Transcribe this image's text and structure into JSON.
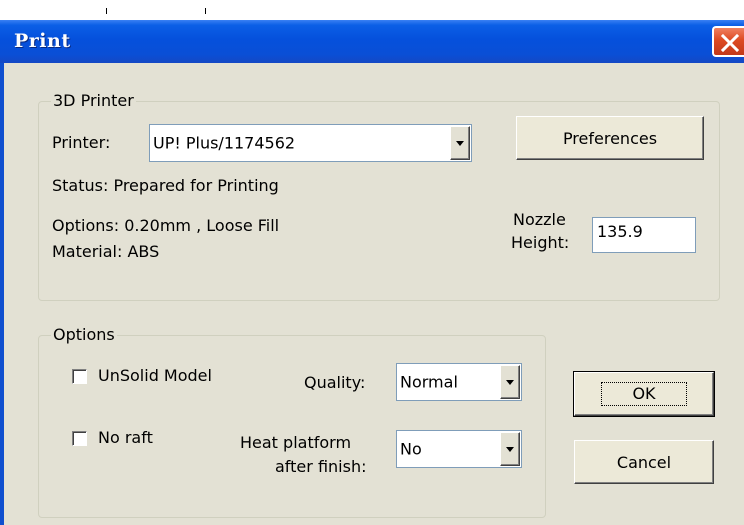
{
  "window": {
    "title": "Print"
  },
  "printer_group": {
    "legend": "3D Printer",
    "printer_label": "Printer:",
    "printer_value": "UP! Plus/1174562",
    "preferences_label": "Preferences",
    "status": "Status: Prepared for Printing",
    "options_text": "Options: 0.20mm , Loose Fill",
    "material_text": "Material: ABS",
    "nozzle_label_line1": "Nozzle",
    "nozzle_label_line2": "Height:",
    "nozzle_value": "135.9"
  },
  "options_group": {
    "legend": "Options",
    "unsolid_label": "UnSolid Model",
    "unsolid_checked": false,
    "noraft_label": "No raft",
    "noraft_checked": false,
    "quality_label": "Quality:",
    "quality_value": "Normal",
    "heat_label_line1": "Heat platform",
    "heat_label_line2": "after finish:",
    "heat_value": "No"
  },
  "buttons": {
    "ok_label": "OK",
    "cancel_label": "Cancel"
  },
  "icons": {
    "close": "close-icon",
    "dropdown": "chevron-down-icon"
  },
  "colors": {
    "titlebar": "#0550dc",
    "close_button": "#dd4a22",
    "dialog_bg": "#e3e1d4"
  }
}
